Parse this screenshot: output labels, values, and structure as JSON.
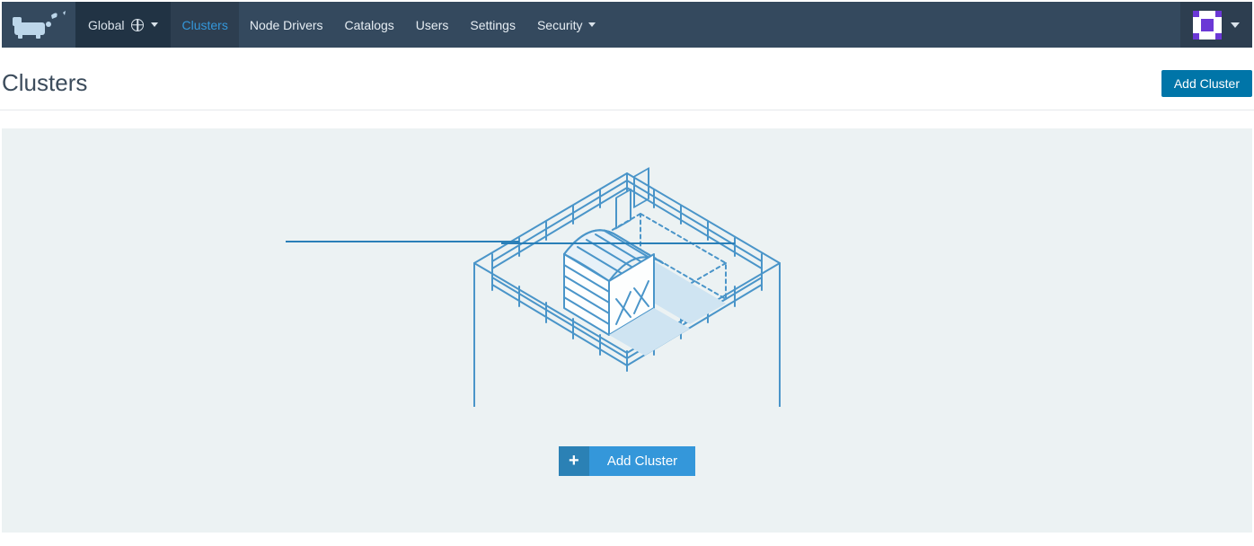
{
  "nav": {
    "scope_label": "Global",
    "items": [
      {
        "label": "Clusters",
        "active": true,
        "has_caret": false
      },
      {
        "label": "Node Drivers",
        "active": false,
        "has_caret": false
      },
      {
        "label": "Catalogs",
        "active": false,
        "has_caret": false
      },
      {
        "label": "Users",
        "active": false,
        "has_caret": false
      },
      {
        "label": "Settings",
        "active": false,
        "has_caret": false
      },
      {
        "label": "Security",
        "active": false,
        "has_caret": true
      }
    ]
  },
  "page": {
    "title": "Clusters",
    "add_button": "Add Cluster"
  },
  "empty": {
    "cta_label": "Add Cluster",
    "cta_icon": "+"
  },
  "colors": {
    "nav_bg": "#34495e",
    "accent": "#3497da",
    "primary_btn": "#0075a8"
  }
}
